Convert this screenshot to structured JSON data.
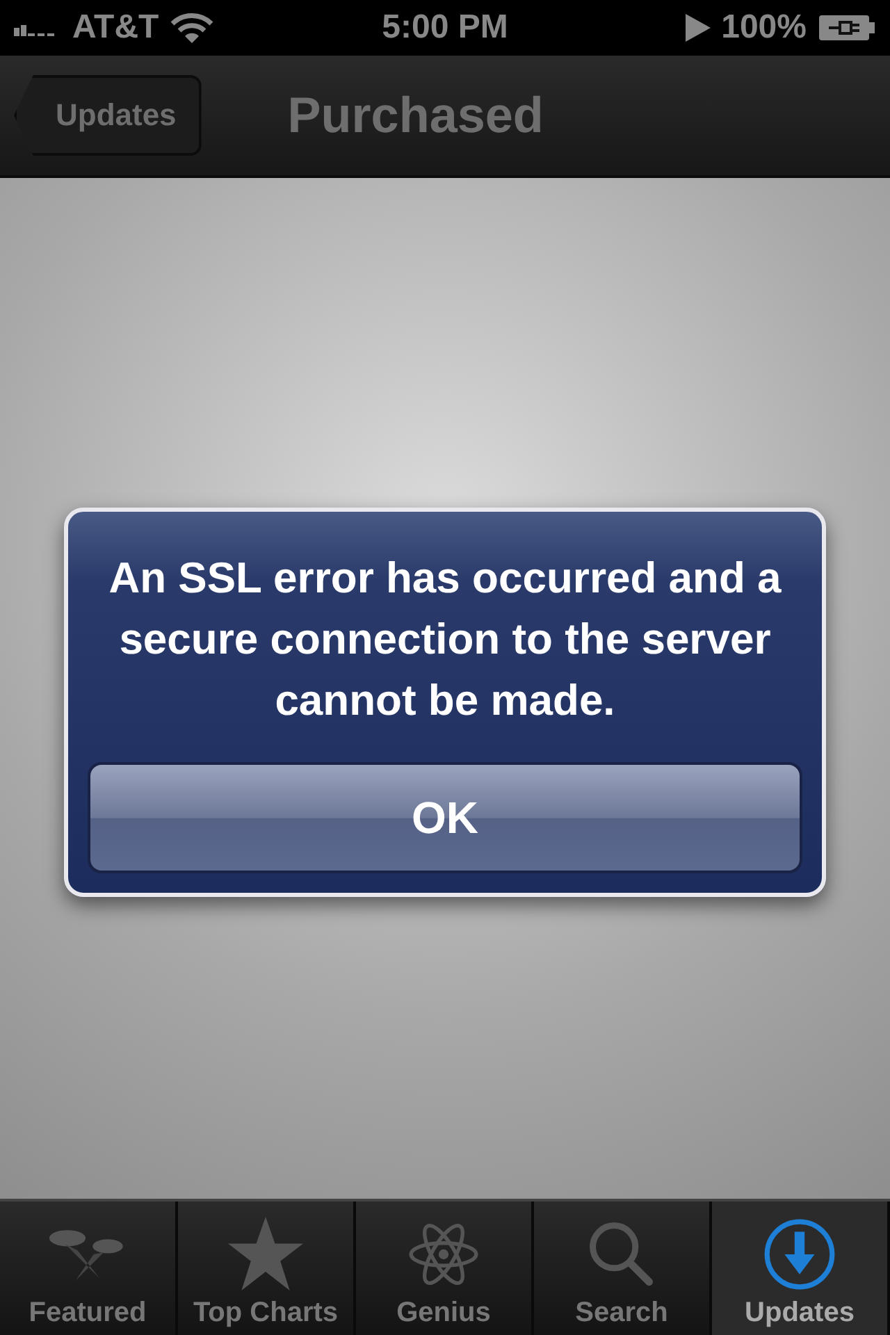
{
  "status_bar": {
    "carrier": "AT&T",
    "time": "5:00 PM",
    "battery": "100%"
  },
  "nav_bar": {
    "back_button": "Updates",
    "title": "Purchased"
  },
  "alert": {
    "message": "An SSL error has occurred and a secure connection to the server cannot be made.",
    "buttons": [
      "OK"
    ]
  },
  "tab_bar": [
    {
      "label": "Featured",
      "kind": "featured",
      "selected": false
    },
    {
      "label": "Top Charts",
      "kind": "star",
      "selected": false
    },
    {
      "label": "Genius",
      "kind": "atom",
      "selected": false
    },
    {
      "label": "Search",
      "kind": "search",
      "selected": false
    },
    {
      "label": "Updates",
      "kind": "updates",
      "selected": true
    }
  ]
}
